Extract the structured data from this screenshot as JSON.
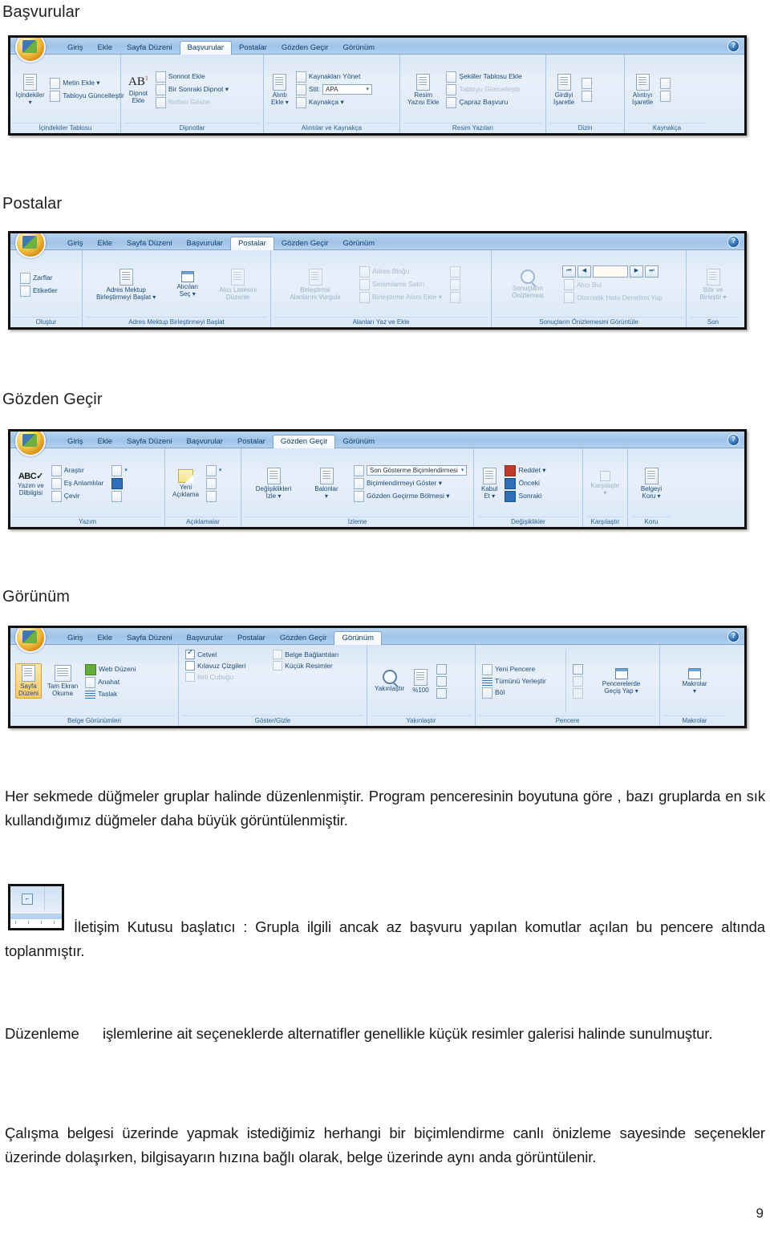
{
  "document": {
    "page_number": "9",
    "sections": [
      {
        "heading": "Başvurular",
        "ribbon": {
          "active_tab": "Başvurular",
          "tabs": [
            "Giriş",
            "Ekle",
            "Sayfa Düzeni",
            "Başvurular",
            "Postalar",
            "Gözden Geçir",
            "Görünüm"
          ],
          "help_icon": "help-icon",
          "groups": [
            {
              "label": "İçindekiler Tablosu",
              "big_buttons": [
                {
                  "caption1": "İçindekiler",
                  "caption2": "▾",
                  "icon": "table-of-contents-icon"
                }
              ],
              "small_buttons": [
                {
                  "label": "Metin Ekle ▾",
                  "icon": "add-text-icon",
                  "disabled": false
                },
                {
                  "label": "Tabloyu Güncelleştir",
                  "icon": "update-table-icon",
                  "disabled": false
                }
              ],
              "has_launcher": false
            },
            {
              "label": "Dipnotlar",
              "big_buttons": [
                {
                  "caption1": "Dipnot",
                  "caption2": "Ekle",
                  "icon": "insert-footnote-icon"
                }
              ],
              "small_buttons": [
                {
                  "label": "Sonnot Ekle",
                  "icon": "insert-endnote-icon",
                  "disabled": false
                },
                {
                  "label": "Bir Sonraki Dipnot ▾",
                  "icon": "next-footnote-icon",
                  "disabled": false
                },
                {
                  "label": "Notları Göster",
                  "icon": "show-notes-icon",
                  "disabled": true
                }
              ],
              "has_launcher": true
            },
            {
              "label": "Alıntılar ve Kaynakça",
              "big_buttons": [
                {
                  "caption1": "Alıntı",
                  "caption2": "Ekle ▾",
                  "icon": "insert-citation-icon"
                }
              ],
              "small_buttons": [
                {
                  "label": "Kaynakları Yönet",
                  "icon": "manage-sources-icon",
                  "disabled": false
                },
                {
                  "label": "Stil:",
                  "icon": "style-icon",
                  "disabled": false,
                  "combo": "APA"
                },
                {
                  "label": "Kaynakça ▾",
                  "icon": "bibliography-icon",
                  "disabled": false
                }
              ],
              "has_launcher": false
            },
            {
              "label": "Resim Yazıları",
              "big_buttons": [
                {
                  "caption1": "Resim",
                  "caption2": "Yazısı Ekle",
                  "icon": "insert-caption-icon"
                }
              ],
              "small_buttons": [
                {
                  "label": "Şekiller Tablosu Ekle",
                  "icon": "insert-table-of-figures-icon",
                  "disabled": false
                },
                {
                  "label": "Tabloyu Güncelleştir",
                  "icon": "update-table-icon",
                  "disabled": true
                },
                {
                  "label": "Çapraz Başvuru",
                  "icon": "cross-reference-icon",
                  "disabled": false
                }
              ],
              "has_launcher": false
            },
            {
              "label": "Dizin",
              "big_buttons": [
                {
                  "caption1": "Girdiyi",
                  "caption2": "İşaretle",
                  "icon": "mark-entry-icon"
                }
              ],
              "small_buttons": [
                {
                  "label": "",
                  "icon": "insert-index-icon",
                  "disabled": false
                },
                {
                  "label": "",
                  "icon": "update-index-icon",
                  "disabled": true
                }
              ],
              "has_launcher": false
            },
            {
              "label": "Kaynakça",
              "big_buttons": [
                {
                  "caption1": "Alıntıyı",
                  "caption2": "İşaretle",
                  "icon": "mark-citation-icon"
                }
              ],
              "small_buttons": [
                {
                  "label": "",
                  "icon": "insert-table-of-authorities-icon",
                  "disabled": false
                },
                {
                  "label": "",
                  "icon": "update-table-icon",
                  "disabled": true
                }
              ],
              "has_launcher": false
            }
          ]
        }
      },
      {
        "heading": "Postalar",
        "ribbon": {
          "active_tab": "Postalar",
          "tabs": [
            "Giriş",
            "Ekle",
            "Sayfa Düzeni",
            "Başvurular",
            "Postalar",
            "Gözden Geçir",
            "Görünüm"
          ],
          "help_icon": "help-icon",
          "groups": [
            {
              "label": "Oluştur",
              "big_buttons": [],
              "small_buttons": [
                {
                  "label": "Zarflar",
                  "icon": "envelopes-icon",
                  "disabled": false
                },
                {
                  "label": "Etiketler",
                  "icon": "labels-icon",
                  "disabled": false
                }
              ],
              "has_launcher": false
            },
            {
              "label": "Adres Mektup Birleştirmeyi Başlat",
              "big_buttons": [
                {
                  "caption1": "Adres Mektup",
                  "caption2": "Birleştirmeyi Başlat ▾",
                  "icon": "start-mail-merge-icon"
                },
                {
                  "caption1": "Alıcıları",
                  "caption2": "Seç ▾",
                  "icon": "select-recipients-icon"
                },
                {
                  "caption1": "Alıcı Listesini",
                  "caption2": "Düzenle",
                  "icon": "edit-recipient-list-icon",
                  "disabled": true
                }
              ],
              "small_buttons": [],
              "has_launcher": false
            },
            {
              "label": "Alanları Yaz ve Ekle",
              "big_buttons": [
                {
                  "caption1": "Birleştirme",
                  "caption2": "Alanlarını Vurgula",
                  "icon": "highlight-merge-fields-icon",
                  "disabled": true
                }
              ],
              "small_buttons": [
                {
                  "label": "Adres Bloğu",
                  "icon": "address-block-icon",
                  "disabled": true
                },
                {
                  "label": "Selamlama Satırı",
                  "icon": "greeting-line-icon",
                  "disabled": true
                },
                {
                  "label": "Birleştirme Alanı Ekle ▾",
                  "icon": "insert-merge-field-icon",
                  "disabled": true
                }
              ],
              "has_launcher": false
            },
            {
              "label": "Sonuçların Önizlemesini Görüntüle",
              "big_buttons": [
                {
                  "caption1": "Sonuçların",
                  "caption2": "Önizlemesi",
                  "icon": "preview-results-icon",
                  "disabled": true
                }
              ],
              "small_buttons": [
                {
                  "label": "Alıcı Bul",
                  "icon": "find-recipient-icon",
                  "disabled": true
                },
                {
                  "label": "Otomatik Hata Denetimi Yap",
                  "icon": "auto-check-errors-icon",
                  "disabled": true
                }
              ],
              "record_nav": {
                "first": "⏮",
                "prev": "◀",
                "value": "",
                "next": "▶",
                "last": "⏭"
              },
              "has_launcher": false
            },
            {
              "label": "Son",
              "big_buttons": [
                {
                  "caption1": "Bitir ve",
                  "caption2": "Birleştir ▾",
                  "icon": "finish-and-merge-icon",
                  "disabled": true
                }
              ],
              "small_buttons": [],
              "has_launcher": false
            }
          ]
        }
      },
      {
        "heading": "Gözden Geçir",
        "ribbon": {
          "active_tab": "Gözden Geçir",
          "tabs": [
            "Giriş",
            "Ekle",
            "Sayfa Düzeni",
            "Başvurular",
            "Postalar",
            "Gözden Geçir",
            "Görünüm"
          ],
          "help_icon": "help-icon",
          "groups": [
            {
              "label": "Yazım",
              "big_buttons": [
                {
                  "caption1": "Yazım ve",
                  "caption2": "Dilbilgisi",
                  "icon": "spelling-grammar-icon"
                }
              ],
              "small_buttons": [
                {
                  "label": "Araştır",
                  "icon": "research-icon",
                  "disabled": false
                },
                {
                  "label": "Eş Anlamlılar",
                  "icon": "thesaurus-icon",
                  "disabled": false
                },
                {
                  "label": "Çevir",
                  "icon": "translate-icon",
                  "disabled": false
                }
              ],
              "extra_icons": [
                "translation-screentip-icon",
                "set-language-icon",
                "word-count-icon"
              ],
              "has_launcher": false
            },
            {
              "label": "Açıklamalar",
              "big_buttons": [
                {
                  "caption1": "Yeni",
                  "caption2": "Açıklama",
                  "icon": "new-comment-icon"
                }
              ],
              "small_buttons": [
                {
                  "label": "",
                  "icon": "delete-comment-icon",
                  "disabled": false
                },
                {
                  "label": "",
                  "icon": "previous-comment-icon",
                  "disabled": false
                },
                {
                  "label": "",
                  "icon": "next-comment-icon",
                  "disabled": false
                }
              ],
              "has_launcher": false
            },
            {
              "label": "İzleme",
              "big_buttons": [
                {
                  "caption1": "Değişiklikleri",
                  "caption2": "İzle ▾",
                  "icon": "track-changes-icon"
                },
                {
                  "caption1": "Balonlar",
                  "caption2": "▾",
                  "icon": "balloons-icon"
                }
              ],
              "small_buttons": [
                {
                  "label": "",
                  "icon": "display-for-review-icon",
                  "disabled": false,
                  "combo": "Son Gösterme Biçimlendirmesi"
                },
                {
                  "label": "Biçimlendirmeyi Göster ▾",
                  "icon": "show-markup-icon",
                  "disabled": false
                },
                {
                  "label": "Gözden Geçirme Bölmesi ▾",
                  "icon": "reviewing-pane-icon",
                  "disabled": false
                }
              ],
              "has_launcher": false
            },
            {
              "label": "Değişiklikler",
              "big_buttons": [
                {
                  "caption1": "Kabul",
                  "caption2": "Et ▾",
                  "icon": "accept-change-icon"
                }
              ],
              "small_buttons": [
                {
                  "label": "Reddet ▾",
                  "icon": "reject-change-icon",
                  "disabled": false
                },
                {
                  "label": "Önceki",
                  "icon": "previous-change-icon",
                  "disabled": false
                },
                {
                  "label": "Sonraki",
                  "icon": "next-change-icon",
                  "disabled": false
                }
              ],
              "has_launcher": false
            },
            {
              "label": "Karşılaştır",
              "big_buttons": [
                {
                  "caption1": "Karşılaştır",
                  "caption2": "▾",
                  "icon": "compare-icon",
                  "disabled": true
                }
              ],
              "small_buttons": [],
              "has_launcher": false
            },
            {
              "label": "Koru",
              "big_buttons": [
                {
                  "caption1": "Belgeyi",
                  "caption2": "Koru ▾",
                  "icon": "protect-document-icon"
                }
              ],
              "small_buttons": [],
              "has_launcher": false
            }
          ]
        }
      },
      {
        "heading": "Görünüm",
        "ribbon": {
          "active_tab": "Görünüm",
          "tabs": [
            "Giriş",
            "Ekle",
            "Sayfa Düzeni",
            "Başvurular",
            "Postalar",
            "Gözden Geçir",
            "Görünüm"
          ],
          "help_icon": "help-icon",
          "groups": [
            {
              "label": "Belge Görünümleri",
              "big_buttons": [
                {
                  "caption1": "Sayfa",
                  "caption2": "Düzeni",
                  "icon": "print-layout-icon",
                  "selected": true
                },
                {
                  "caption1": "Tam Ekran",
                  "caption2": "Okuma",
                  "icon": "full-screen-reading-icon"
                }
              ],
              "small_buttons": [
                {
                  "label": "Web Düzeni",
                  "icon": "web-layout-icon",
                  "disabled": false
                },
                {
                  "label": "Anahat",
                  "icon": "outline-icon",
                  "disabled": false
                },
                {
                  "label": "Taslak",
                  "icon": "draft-icon",
                  "disabled": false
                }
              ],
              "has_launcher": false
            },
            {
              "label": "Göster/Gizle",
              "big_buttons": [],
              "checkboxes": [
                {
                  "label": "Cetvel",
                  "checked": true,
                  "disabled": false
                },
                {
                  "label": "Belge Bağlantıları",
                  "checked": false,
                  "disabled": false
                },
                {
                  "label": "Kılavuz Çizgileri",
                  "checked": false,
                  "disabled": false
                },
                {
                  "label": "Küçük Resimler",
                  "checked": false,
                  "disabled": false
                },
                {
                  "label": "İleti Çubuğu",
                  "checked": false,
                  "disabled": true
                }
              ],
              "small_buttons": [],
              "has_launcher": false
            },
            {
              "label": "Yakınlaştır",
              "big_buttons": [
                {
                  "caption1": "Yakınlaştır",
                  "caption2": "",
                  "icon": "zoom-icon"
                },
                {
                  "caption1": "%100",
                  "caption2": "",
                  "icon": "zoom-100-icon"
                }
              ],
              "small_buttons": [
                {
                  "label": "",
                  "icon": "one-page-icon",
                  "disabled": false
                },
                {
                  "label": "",
                  "icon": "two-pages-icon",
                  "disabled": false
                },
                {
                  "label": "",
                  "icon": "page-width-icon",
                  "disabled": false
                }
              ],
              "has_launcher": false
            },
            {
              "label": "Pencere",
              "big_buttons": [
                {
                  "caption1": "Pencerelerde",
                  "caption2": "Geçiş Yap ▾",
                  "icon": "switch-windows-icon"
                }
              ],
              "small_buttons": [
                {
                  "label": "Yeni Pencere",
                  "icon": "new-window-icon",
                  "disabled": false
                },
                {
                  "label": "Tümünü Yerleştir",
                  "icon": "arrange-all-icon",
                  "disabled": false
                },
                {
                  "label": "Böl",
                  "icon": "split-icon",
                  "disabled": false
                }
              ],
              "extra_icons": [
                "view-side-by-side-icon",
                "synchronous-scrolling-icon",
                "reset-window-position-icon"
              ],
              "has_launcher": false
            },
            {
              "label": "Makrolar",
              "big_buttons": [
                {
                  "caption1": "Makrolar",
                  "caption2": "▾",
                  "icon": "macros-icon"
                }
              ],
              "small_buttons": [],
              "has_launcher": false
            }
          ]
        }
      }
    ],
    "paragraphs": {
      "p1": "Her sekmede düğmeler gruplar halinde düzenlenmiştir. Program penceresinin boyutuna göre , bazı gruplarda en sık kullandığımız düğmeler daha büyük görüntülenmiştir.",
      "p2": "İletişim Kutusu başlatıcı : Grupla ilgili ancak az başvuru yapılan komutlar açılan bu pencere altında toplanmıştır.",
      "p3_lead": "Düzenleme",
      "p3_rest": "işlemlerine ait seçeneklerde alternatifler genellikle küçük resimler galerisi halinde sunulmuştur.",
      "p4": "Çalışma belgesi üzerinde yapmak istediğimiz herhangi bir biçimlendirme canlı önizleme sayesinde seçenekler üzerinde dolaşırken, bilgisayarın hızına bağlı olarak, belge üzerinde aynı anda görüntülenir."
    },
    "launcher_figure": {
      "icon": "dialog-box-launcher-icon",
      "glyph": "⌐"
    }
  }
}
